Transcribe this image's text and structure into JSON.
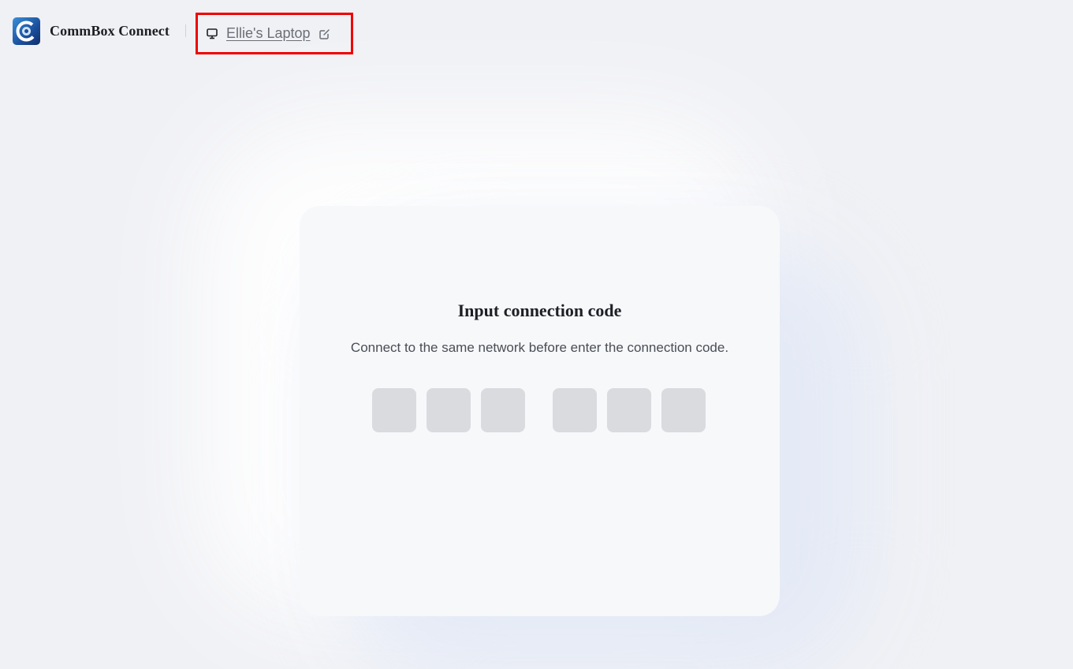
{
  "header": {
    "app_name": "CommBox Connect",
    "logo_icon": "commbox-logo-icon",
    "device": {
      "icon": "monitor-icon",
      "name": "Ellie's Laptop",
      "edit_icon": "edit-icon"
    }
  },
  "card": {
    "title": "Input connection code",
    "subtitle": "Connect to the same network before enter the connection code.",
    "code_digits": [
      "",
      "",
      "",
      "",
      "",
      ""
    ]
  },
  "colors": {
    "background": "#f0f1f5",
    "card": "#f7f8fa",
    "code_box": "#d9dbdf",
    "highlight_border": "#ee0000",
    "logo_primary": "#1b4f9c"
  }
}
